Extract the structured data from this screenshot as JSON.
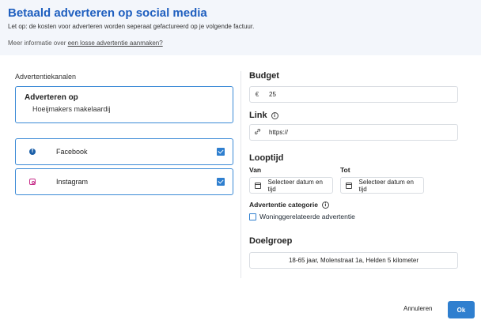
{
  "header": {
    "title": "Betaald adverteren op social media",
    "note": "Let op: de kosten voor adverteren worden seperaat gefactureerd op je volgende factuur.",
    "info_prefix": "Meer informatie over ",
    "info_link": "een losse advertentie aanmaken?"
  },
  "channels_section": {
    "label": "Advertentiekanalen",
    "account_title": "Adverteren op",
    "account_name": "Hoeijmakers makelaardij",
    "items": [
      {
        "name": "Facebook",
        "icon": "facebook-icon",
        "checked": true
      },
      {
        "name": "Instagram",
        "icon": "instagram-icon",
        "checked": true
      }
    ]
  },
  "budget": {
    "label": "Budget",
    "currency": "€",
    "value": "25"
  },
  "link": {
    "label": "Link",
    "icon": "link-icon",
    "placeholder": "https://"
  },
  "runtime": {
    "label": "Looptijd",
    "from_label": "Van",
    "from_button": "Selecteer datum en tijd",
    "to_label": "Tot",
    "to_button": "Selecteer datum en tijd"
  },
  "category": {
    "label": "Advertentie categorie",
    "checkbox_label": "Woninggerelateerde advertentie",
    "checked": false
  },
  "audience": {
    "label": "Doelgroep",
    "value": "18-65 jaar, Molenstraat 1a, Helden 5 kilometer"
  },
  "footer": {
    "cancel_label": "Annuleren",
    "ok_label": "Ok"
  },
  "colors": {
    "accent": "#2f7fcf",
    "title": "#1f5fbf",
    "header_bg": "#f3f6fb"
  }
}
